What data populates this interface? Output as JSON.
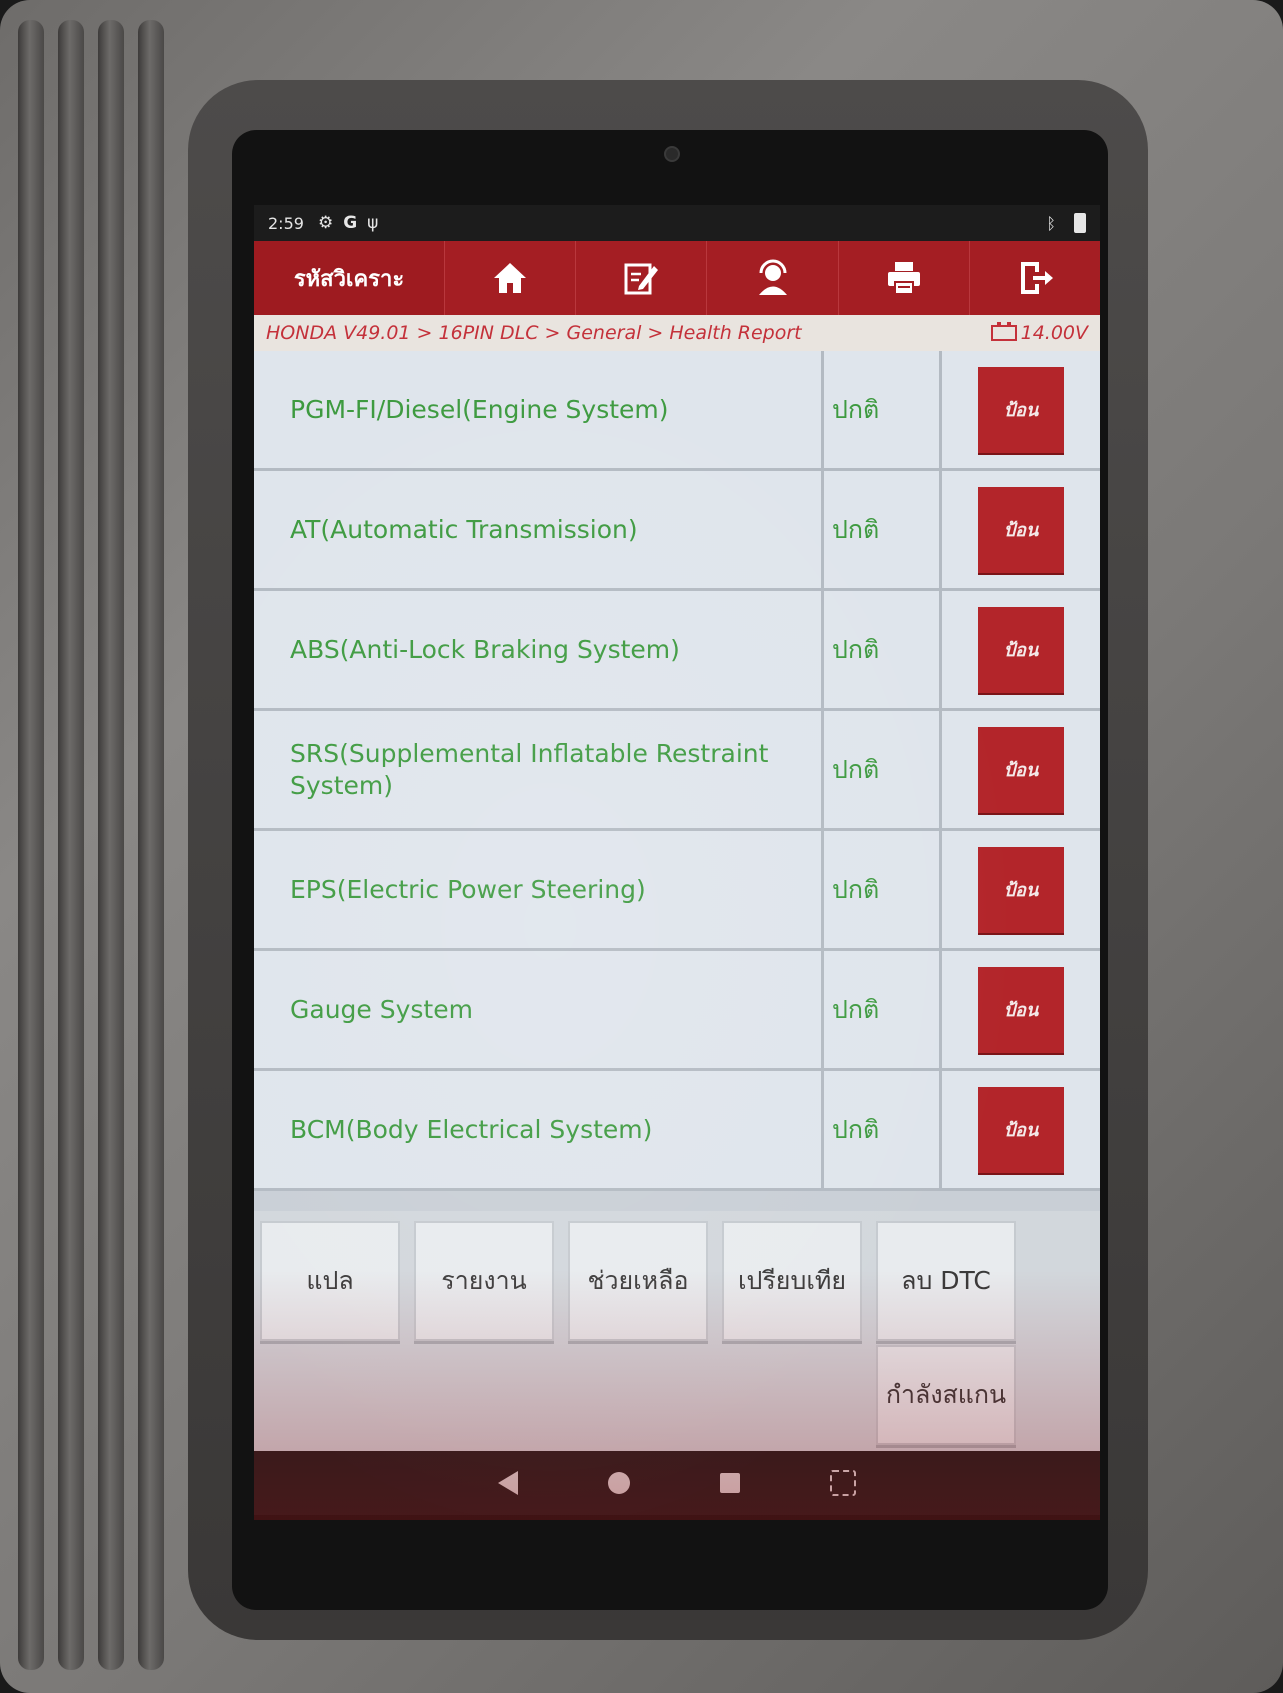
{
  "status_bar": {
    "time": "2:59",
    "left_icons": [
      "settings-gear-icon",
      "google-icon",
      "diagnostic-stethoscope-icon"
    ],
    "right_icons": [
      "bluetooth-icon",
      "battery-icon"
    ]
  },
  "app_bar": {
    "title": "รหัสวิเคราะ",
    "toolbar": [
      {
        "name": "home-icon"
      },
      {
        "name": "edit-icon"
      },
      {
        "name": "support-agent-icon"
      },
      {
        "name": "print-icon"
      },
      {
        "name": "exit-icon"
      }
    ]
  },
  "breadcrumb": {
    "path": "HONDA V49.01 > 16PIN DLC > General > Health Report",
    "voltage": "14.00V",
    "icon": "car-battery-icon"
  },
  "systems": [
    {
      "name": "PGM-FI/Diesel(Engine System)",
      "status": "ปกติ",
      "action": "ป้อน"
    },
    {
      "name": "AT(Automatic Transmission)",
      "status": "ปกติ",
      "action": "ป้อน"
    },
    {
      "name": "ABS(Anti-Lock Braking System)",
      "status": "ปกติ",
      "action": "ป้อน"
    },
    {
      "name": "SRS(Supplemental Inflatable Restraint System)",
      "status": "ปกติ",
      "action": "ป้อน"
    },
    {
      "name": "EPS(Electric Power Steering)",
      "status": "ปกติ",
      "action": "ป้อน"
    },
    {
      "name": "Gauge System",
      "status": "ปกติ",
      "action": "ป้อน"
    },
    {
      "name": "BCM(Body Electrical System)",
      "status": "ปกติ",
      "action": "ป้อน"
    }
  ],
  "bottom_buttons": {
    "translate": "แปล",
    "report": "รายงาน",
    "help": "ช่วยเหลือ",
    "compare": "เปรียบเทีย",
    "clear_dtc": "ลบ DTC",
    "scanning": "กำลังสแกน"
  },
  "colors": {
    "brand_red": "#9e1b20",
    "status_green": "#3d9a3f",
    "breadcrumb_red": "#c4313a"
  }
}
